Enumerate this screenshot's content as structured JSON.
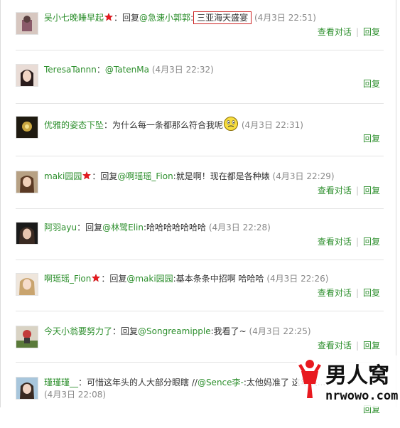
{
  "comments": [
    {
      "user": "吴小七晚睡早起",
      "verified": true,
      "sep": "：",
      "reply_prefix": "回复",
      "mention": "@急速小郭郭",
      "mention_sep": ":",
      "text": "三亚海天盛宴",
      "time": "(4月3日 22:51)",
      "actions": [
        "查看对话",
        "回复"
      ]
    },
    {
      "user": "TeresaTannn",
      "verified": false,
      "sep": "：",
      "mention": "@TatenMa",
      "time": "(4月3日 22:32)",
      "actions": [
        "回复"
      ]
    },
    {
      "user": "优雅的姿态下坠",
      "verified": false,
      "sep": "：",
      "text": "为什么每一条都那么符合我呢",
      "emoji": "smiley-face-emoji",
      "time": "(4月3日 22:31)",
      "actions": [
        "回复"
      ]
    },
    {
      "user": "maki园园",
      "verified": true,
      "sep": "：",
      "reply_prefix": "回复",
      "mention": "@啊瑶瑶_Fion",
      "text": ":就是啊！现在都是各种婊",
      "time": "(4月3日 22:29)",
      "actions": [
        "查看对话",
        "回复"
      ]
    },
    {
      "user": "阿羽ayu",
      "verified": false,
      "sep": "：",
      "reply_prefix": "回复",
      "mention": "@林鹭Elin",
      "text": ":哈哈哈哈哈哈哈",
      "time": "(4月3日 22:28)",
      "actions": [
        "查看对话",
        "回复"
      ]
    },
    {
      "user": "啊瑶瑶_Fion",
      "verified": true,
      "sep": "：",
      "reply_prefix": "回复",
      "mention": "@maki园园",
      "text": ":基本条条中招啊 哈哈哈",
      "time": "(4月3日 22:26)",
      "actions": [
        "查看对话",
        "回复"
      ]
    },
    {
      "user": "今天小翁要努力了",
      "verified": false,
      "sep": "：",
      "reply_prefix": "回复",
      "mention": "@Songreamipple",
      "text": ":我看了~",
      "time": "(4月3日 22:25)",
      "actions": [
        "查看对话",
        "回复"
      ]
    },
    {
      "user": "瑾瑾瑾__",
      "verified": false,
      "sep": "：",
      "text": "可惜这年头的人大部分眼瞎 //",
      "mention": "@Sence李-",
      "text2": ":太他妈准了 这年头...",
      "time": "(4月3日 22:08)",
      "actions": [
        "回复"
      ]
    }
  ],
  "watermark": {
    "brand": "男人窝",
    "url": "nrwowo.com",
    "brand_color": "#e8191f"
  },
  "colors": {
    "username": "#2d8f2d",
    "time": "#888888",
    "highlight_box": "#cc2222"
  }
}
